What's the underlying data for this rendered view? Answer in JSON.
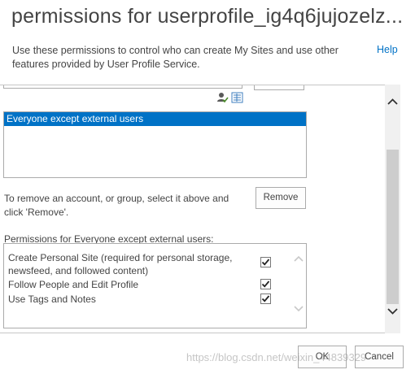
{
  "dialog": {
    "title": "permissions for userprofile_ig4q6jujozelz...",
    "description": "Use these permissions to control who can create My Sites and use other features provided by User Profile Service.",
    "help_label": "Help"
  },
  "groups": {
    "items": [
      {
        "label": "Everyone except external users",
        "selected": true
      }
    ],
    "icons": [
      "check-names-icon",
      "browse-directory-icon"
    ]
  },
  "remove": {
    "instruction": "To remove an account, or group, select it above and click 'Remove'.",
    "button_label": "Remove"
  },
  "permissions": {
    "label": "Permissions for Everyone except external users:",
    "items": [
      {
        "label": "Create Personal Site (required for personal storage, newsfeed, and followed content)",
        "checked": true
      },
      {
        "label": "Follow People and Edit Profile",
        "checked": true
      },
      {
        "label": "Use Tags and Notes",
        "checked": true
      }
    ]
  },
  "footer": {
    "ok_label": "OK",
    "cancel_label": "Cancel"
  },
  "watermark": "https://blog.csdn.net/weixin_44839329",
  "colors": {
    "selection": "#0072c6",
    "link": "#0072c6",
    "text": "#444444",
    "border": "#ababab"
  }
}
